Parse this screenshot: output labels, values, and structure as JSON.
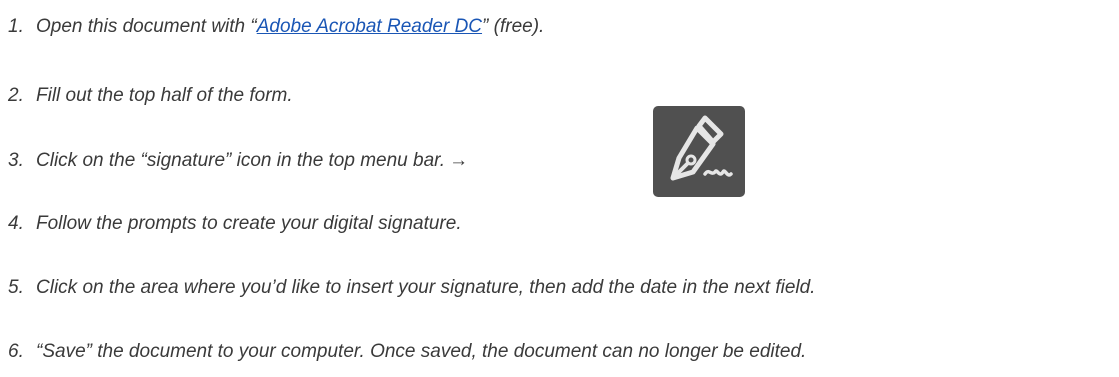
{
  "steps": [
    {
      "num": "1.",
      "before": "Open this document with “",
      "link": "Adobe Acrobat Reader DC",
      "after": "” (free)."
    },
    {
      "num": "2.",
      "text": "Fill out the top half of the form."
    },
    {
      "num": "3.",
      "text": "Click on the “signature” icon in the top menu bar.",
      "arrow": "→"
    },
    {
      "num": "4.",
      "text": "Follow the prompts to create your digital signature."
    },
    {
      "num": "5.",
      "text": "Click on the area where you’d like to insert your signature, then add the date in the next field."
    },
    {
      "num": "6.",
      "text": "“Save” the document to your computer. Once saved, the document can no longer be edited."
    }
  ],
  "icons": {
    "signature": "signature-pen-icon"
  },
  "colors": {
    "text": "#3a3a3a",
    "link": "#1a56b5",
    "icon_bg": "#505050",
    "icon_fg": "#e6e6e6"
  }
}
